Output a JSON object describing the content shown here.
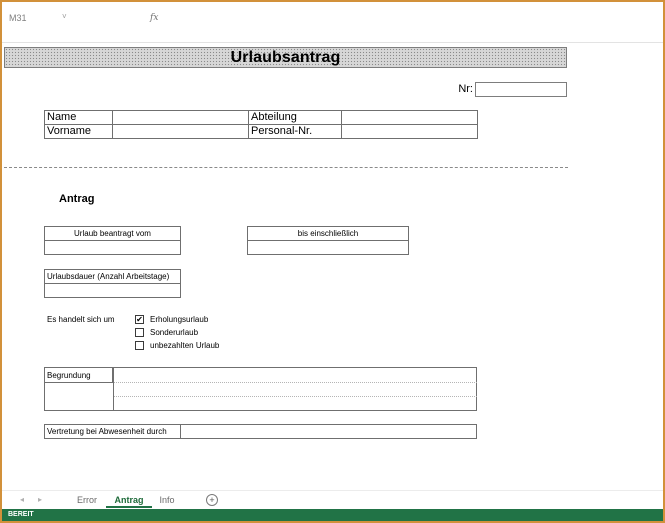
{
  "formula_bar": {
    "name_box": "M31",
    "name_box_arrow": "˅",
    "fx_label": "fx",
    "formula_value": ""
  },
  "form": {
    "title": "Urlaubsantrag",
    "nr_label": "Nr:",
    "nr_value": "",
    "person": {
      "name_label": "Name",
      "name_value": "",
      "abteilung_label": "Abteilung",
      "abteilung_value": "",
      "vorname_label": "Vorname",
      "vorname_value": "",
      "personal_nr_label": "Personal-Nr.",
      "personal_nr_value": ""
    },
    "antrag_heading": "Antrag",
    "urlaub_vom_label": "Urlaub beantragt vom",
    "urlaub_vom_value": "",
    "bis_label": "bis einschließlich",
    "bis_value": "",
    "dauer_label": "Urlaubsdauer (Anzahl Arbeitstage)",
    "dauer_value": "",
    "handelt_label": "Es handelt sich um",
    "options": [
      {
        "label": "Erholungsurlaub",
        "checked": true,
        "mark": "✔"
      },
      {
        "label": "Sonderurlaub",
        "checked": false,
        "mark": ""
      },
      {
        "label": "unbezahlten Urlaub",
        "checked": false,
        "mark": ""
      }
    ],
    "begruendung_label": "Begrundung",
    "vertretung_label": "Vertretung bei Abwesenheit durch",
    "vertretung_value": ""
  },
  "sheet_tabs": {
    "nav_prev": "◂",
    "nav_next": "▸",
    "tabs": [
      {
        "label": "Error",
        "active": false
      },
      {
        "label": "Antrag",
        "active": true
      },
      {
        "label": "Info",
        "active": false
      }
    ],
    "add_label": "+"
  },
  "status_bar": {
    "text": "BEREIT"
  },
  "colors": {
    "accent_green": "#217346",
    "frame_border": "#d2913a"
  }
}
